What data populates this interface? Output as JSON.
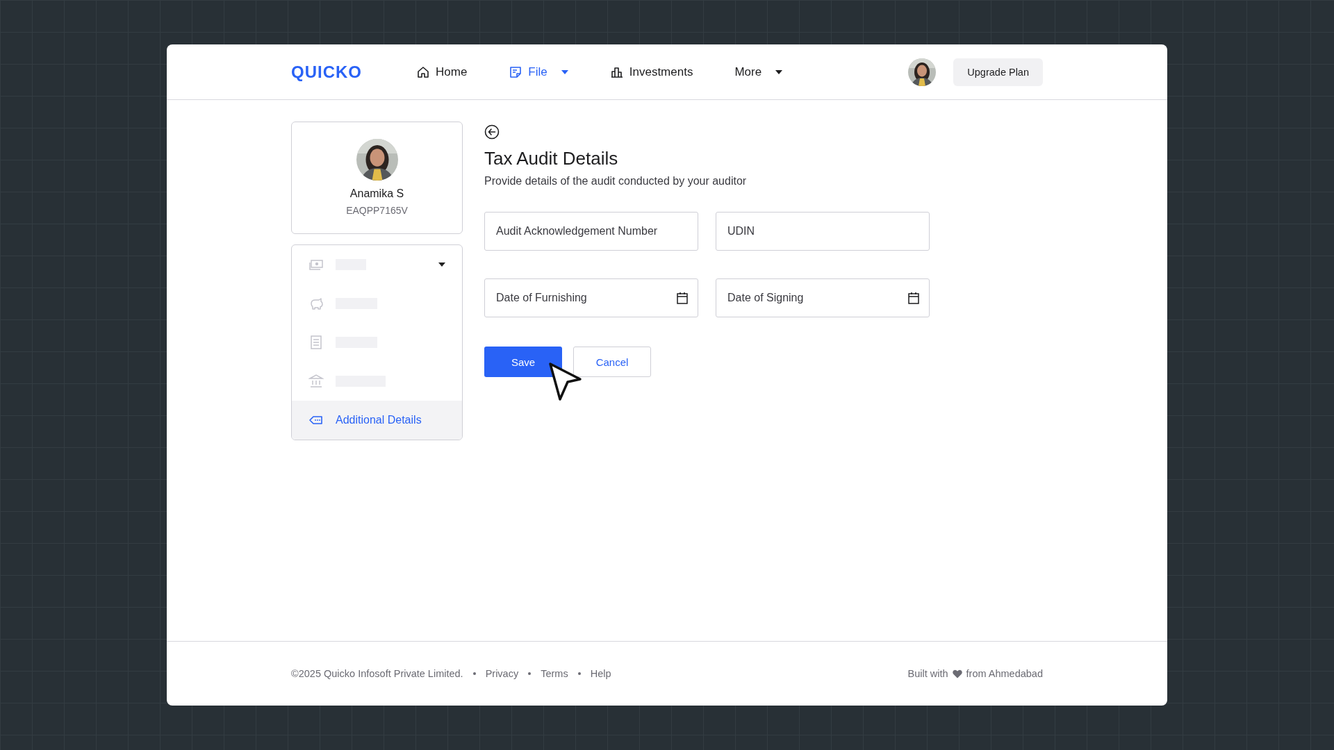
{
  "header": {
    "logo": "QUICKO",
    "nav": [
      {
        "label": "Home",
        "selected": false,
        "dropdown": false
      },
      {
        "label": "File",
        "selected": true,
        "dropdown": true
      },
      {
        "label": "Investments",
        "selected": false,
        "dropdown": false
      },
      {
        "label": "More",
        "selected": false,
        "dropdown": true
      }
    ],
    "upgrade_button": "Upgrade Plan"
  },
  "profile": {
    "name": "Anamika S",
    "pan": "EAQPP7165V"
  },
  "sidebar": {
    "items": [
      {
        "kind": "placeholder",
        "dropdown": true
      },
      {
        "kind": "placeholder",
        "dropdown": false
      },
      {
        "kind": "placeholder",
        "dropdown": false
      },
      {
        "kind": "placeholder",
        "dropdown": false
      },
      {
        "kind": "link",
        "label": "Additional Details",
        "selected": true
      }
    ]
  },
  "form": {
    "title": "Tax Audit Details",
    "subtitle": "Provide details of the audit conducted by your auditor",
    "fields": [
      {
        "kind": "text",
        "placeholder": "Audit Acknowledgement Number"
      },
      {
        "kind": "text",
        "placeholder": "UDIN"
      },
      {
        "kind": "date",
        "placeholder": "Date of Furnishing"
      },
      {
        "kind": "date",
        "placeholder": "Date of Signing"
      }
    ],
    "buttons": [
      {
        "kind": "primary",
        "label": "Save"
      },
      {
        "kind": "secondary",
        "label": "Cancel"
      }
    ]
  },
  "footer": {
    "copyright": "©2025 Quicko Infosoft Private Limited.",
    "links": [
      "Privacy",
      "Terms",
      "Help"
    ],
    "built_with": "Built with",
    "built_from": "from Ahmedabad"
  }
}
